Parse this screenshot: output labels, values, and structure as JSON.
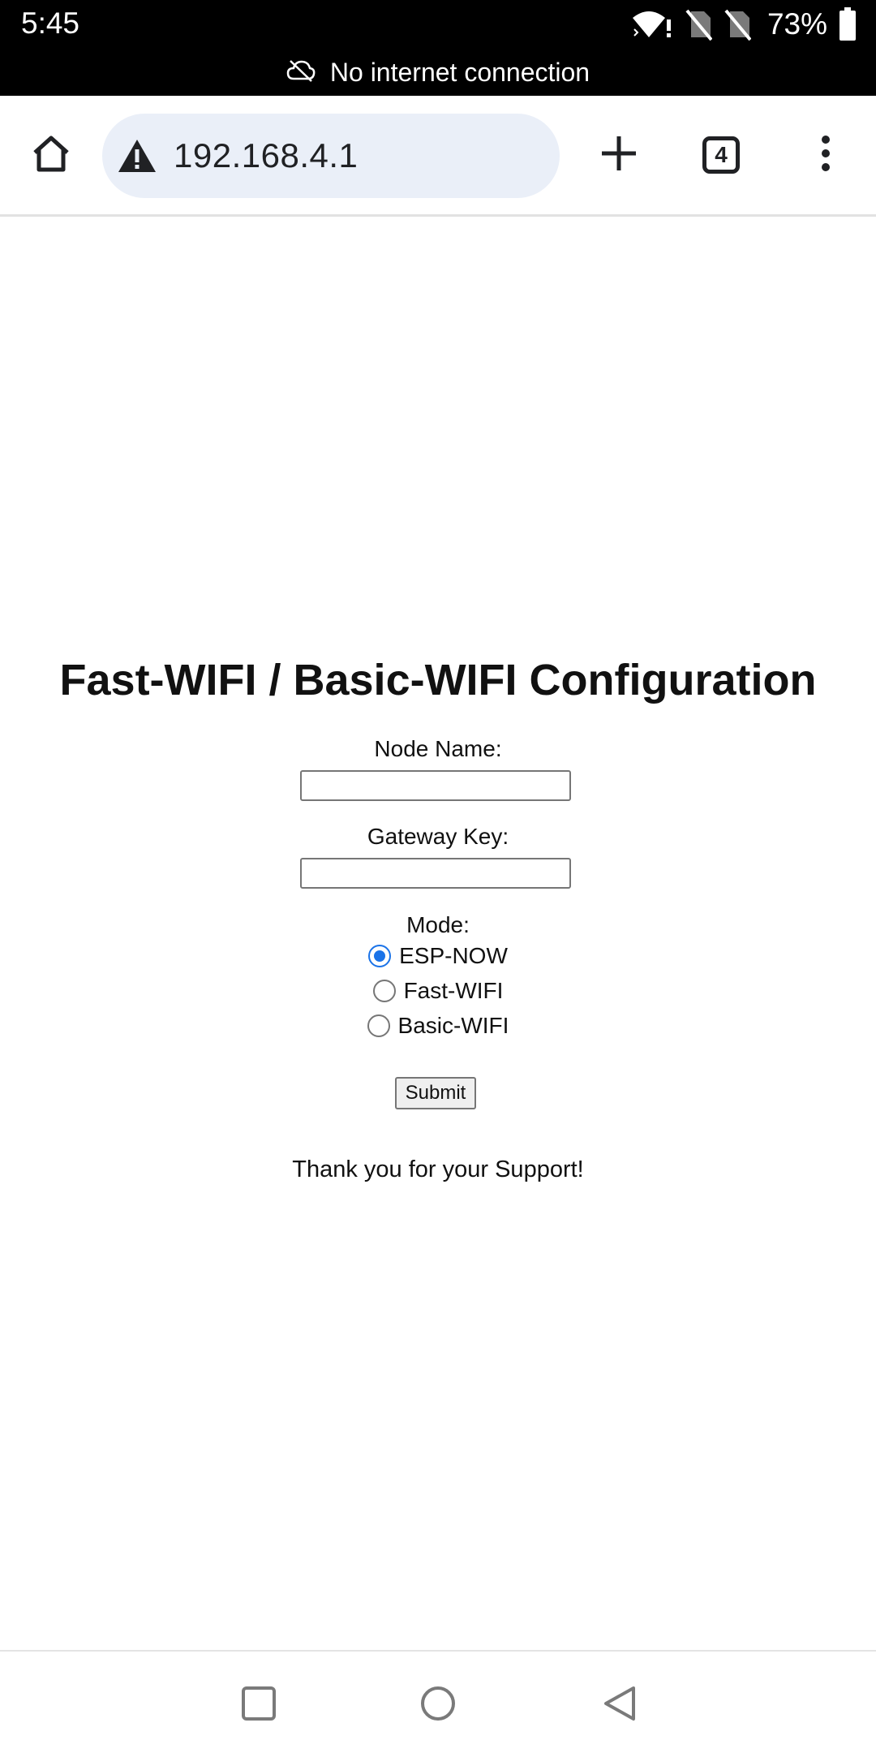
{
  "status_bar": {
    "time": "5:45",
    "battery_percent": "73%",
    "icons": [
      "wifi-alert-icon",
      "no-sim-icon",
      "no-sim-icon",
      "battery-icon"
    ]
  },
  "offline_banner": {
    "icon": "cloud-off-icon",
    "text": "No internet connection"
  },
  "toolbar": {
    "home_icon": "home-icon",
    "security_icon": "warning-icon",
    "url": "192.168.4.1",
    "new_tab_icon": "plus-icon",
    "tab_count": "4",
    "menu_icon": "more-vert-icon"
  },
  "page": {
    "title": "Fast-WIFI / Basic-WIFI Configuration",
    "node_name_label": "Node Name:",
    "node_name_value": "",
    "gateway_key_label": "Gateway Key:",
    "gateway_key_value": "",
    "mode_label": "Mode:",
    "mode_options": [
      {
        "label": "ESP-NOW",
        "checked": true
      },
      {
        "label": "Fast-WIFI",
        "checked": false
      },
      {
        "label": "Basic-WIFI",
        "checked": false
      }
    ],
    "submit_label": "Submit",
    "footer_text": "Thank you for your Support!"
  },
  "nav_bar": {
    "buttons": [
      "recents-icon",
      "home-circle-icon",
      "back-icon"
    ]
  },
  "colors": {
    "radio_accent": "#1a73e8",
    "omnibox_bg": "#eaeff8",
    "status_bg": "#000000"
  }
}
